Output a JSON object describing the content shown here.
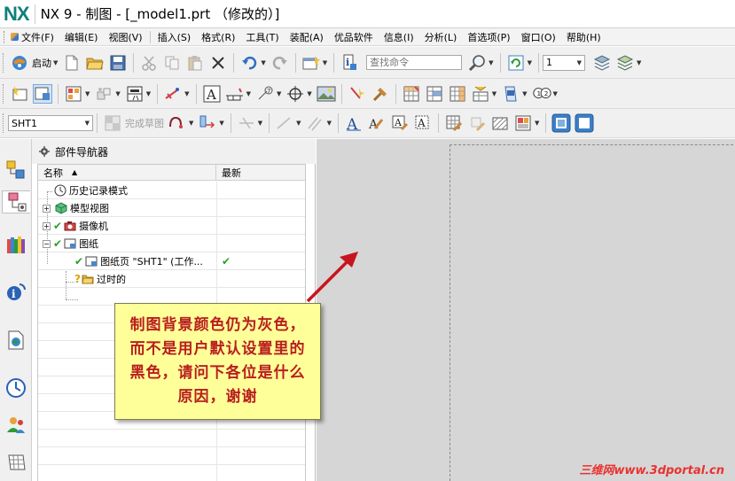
{
  "window": {
    "logo": "NX",
    "title": "NX 9 - 制图 - [_model1.prt （修改的）]"
  },
  "menu": [
    "文件(F)",
    "编辑(E)",
    "视图(V)",
    "插入(S)",
    "格式(R)",
    "工具(T)",
    "装配(A)",
    "优品软件",
    "信息(I)",
    "分析(L)",
    "首选项(P)",
    "窗口(O)",
    "帮助(H)"
  ],
  "toolbar": {
    "start_label": "启动",
    "search_placeholder": "查找命令",
    "layer_value": "1",
    "sheet_value": "SHT1",
    "finish_sketch_label": "完成草图"
  },
  "navigator": {
    "title": "部件导航器",
    "col_name": "名称",
    "col_latest": "最新",
    "rows": [
      {
        "label": "历史记录模式",
        "latest": ""
      },
      {
        "label": "模型视图",
        "latest": ""
      },
      {
        "label": "摄像机",
        "latest": ""
      },
      {
        "label": "图纸",
        "latest": ""
      },
      {
        "label": "图纸页 \"SHT1\" (工作...",
        "latest": "✔"
      },
      {
        "label": "过时的",
        "latest": ""
      }
    ]
  },
  "note": {
    "text": "制图背景颜色仍为灰色，而不是用户默认设置里的黑色，请问下各位是什么原因，谢谢"
  },
  "watermark": "三维网www.3dportal.cn",
  "colors": {
    "logo": "#0f7f7a",
    "canvas_bg": "#d6d6d6",
    "note_bg": "#ffff99",
    "note_text": "#b81e1e",
    "arrow": "#c8141e",
    "check": "#2aa02a"
  }
}
